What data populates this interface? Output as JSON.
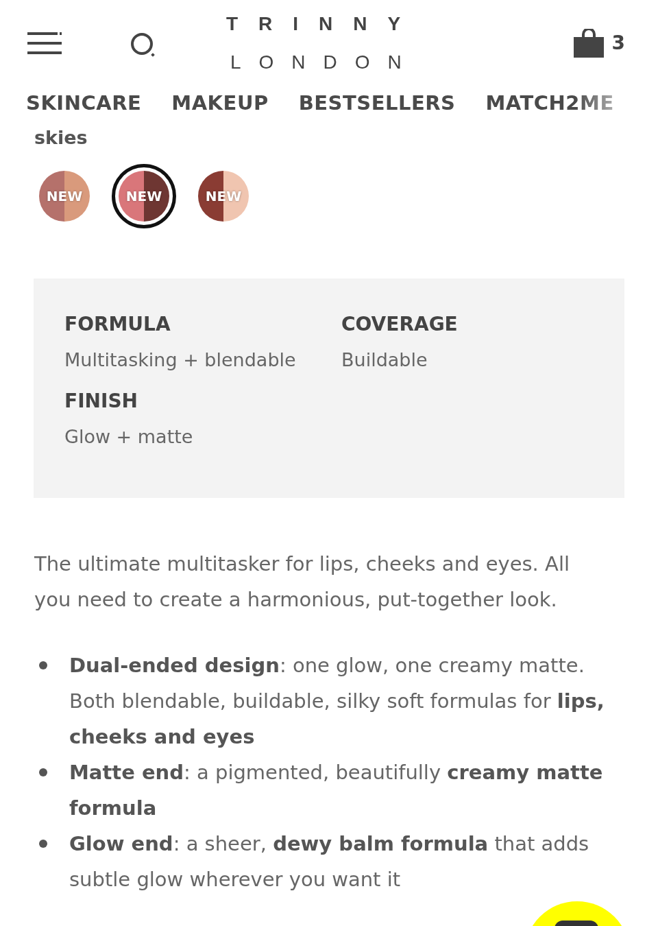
{
  "header": {
    "logo_top": "TRINNY",
    "logo_bottom": "LONDON",
    "cart_count": "3"
  },
  "nav": [
    {
      "label": "SKINCARE"
    },
    {
      "label": "MAKEUP"
    },
    {
      "label": "BESTSELLERS"
    },
    {
      "label": "MATCH2ME"
    }
  ],
  "shade_name": "skies",
  "swatches": [
    {
      "badge": "NEW",
      "selected": false,
      "halves": [
        {
          "color": "#b5716b"
        },
        {
          "color": "#d99a7c"
        }
      ]
    },
    {
      "badge": "NEW",
      "selected": true,
      "halves": [
        {
          "color": "#d9767a"
        },
        {
          "color": "#6e3632"
        }
      ]
    },
    {
      "badge": "NEW",
      "selected": false,
      "halves": [
        {
          "color": "#8a3c33"
        },
        {
          "color": "#f0c5b0"
        }
      ]
    }
  ],
  "specs": [
    {
      "label": "FORMULA",
      "value": "Multitasking + blendable"
    },
    {
      "label": "COVERAGE",
      "value": "Buildable"
    },
    {
      "label": "FINISH",
      "value": "Glow + matte"
    }
  ],
  "description": "The ultimate multitasker for lips, cheeks and eyes. All you need to create a harmonious, put-together look.",
  "bullets": [
    "**Dual-ended design**: one glow, one creamy matte. Both blendable, buildable, silky soft formulas for **lips, cheeks and eyes**",
    "**Matte end**: a pigmented, beautifully **creamy matte formula**",
    "**Glow end**: a sheer, **dewy balm formula** that adds subtle glow wherever you want it"
  ]
}
